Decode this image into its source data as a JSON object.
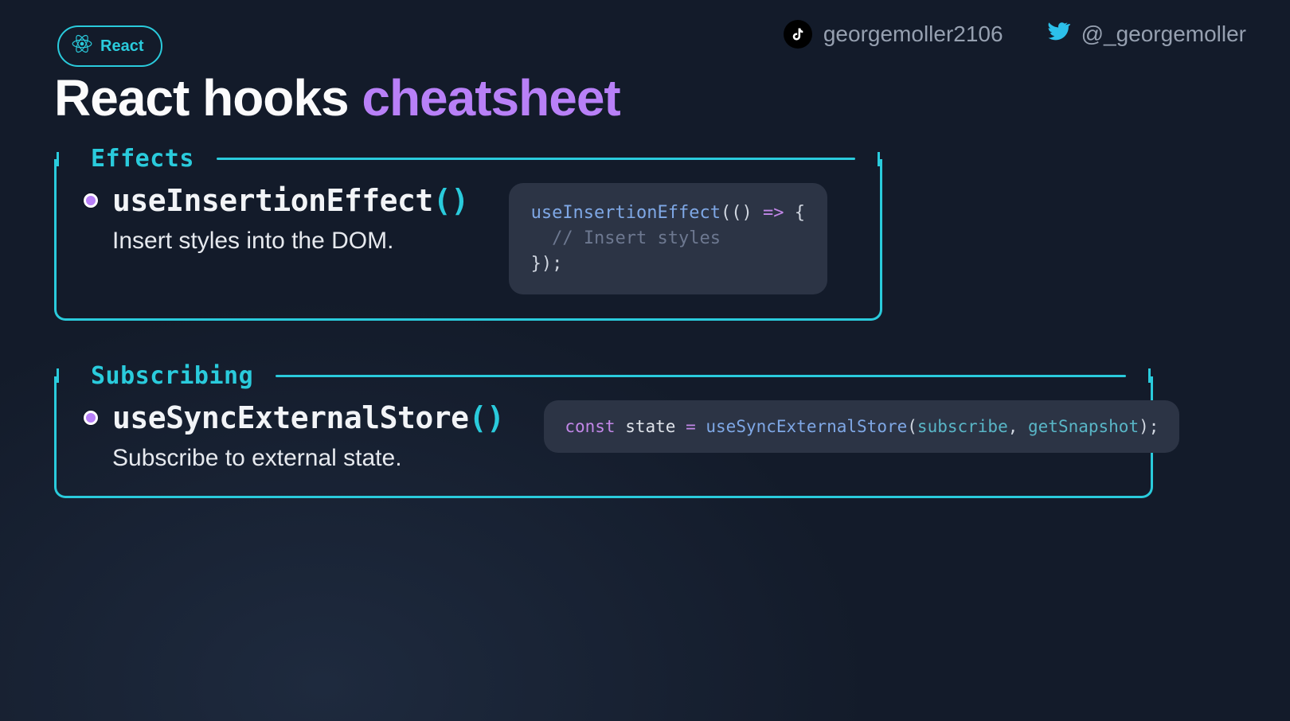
{
  "socials": {
    "tiktok": "georgemoller2106",
    "twitter": "@_georgemoller"
  },
  "badge": {
    "label": "React"
  },
  "title": {
    "prefix": "React hooks ",
    "accent": "cheatsheet"
  },
  "sections": [
    {
      "heading": "Effects",
      "hook_name": "useInsertionEffect",
      "parens": "()",
      "desc": "Insert styles into the DOM.",
      "code_tokens": [
        {
          "t": "fn",
          "v": "useInsertionEffect"
        },
        {
          "t": "",
          "v": "(() "
        },
        {
          "t": "op",
          "v": "=>"
        },
        {
          "t": "",
          "v": " {"
        },
        {
          "t": "br"
        },
        {
          "t": "",
          "v": "  "
        },
        {
          "t": "comment",
          "v": "// Insert styles"
        },
        {
          "t": "br"
        },
        {
          "t": "",
          "v": "});"
        }
      ]
    },
    {
      "heading": "Subscribing",
      "hook_name": "useSyncExternalStore",
      "parens": "()",
      "desc": "Subscribe to external state.",
      "code_tokens": [
        {
          "t": "kw",
          "v": "const"
        },
        {
          "t": "",
          "v": " "
        },
        {
          "t": "id",
          "v": "state"
        },
        {
          "t": "",
          "v": " "
        },
        {
          "t": "op",
          "v": "="
        },
        {
          "t": "",
          "v": " "
        },
        {
          "t": "call",
          "v": "useSyncExternalStore"
        },
        {
          "t": "",
          "v": "("
        },
        {
          "t": "arg",
          "v": "subscribe"
        },
        {
          "t": "",
          "v": ", "
        },
        {
          "t": "arg",
          "v": "getSnapshot"
        },
        {
          "t": "",
          "v": ");"
        }
      ]
    }
  ]
}
